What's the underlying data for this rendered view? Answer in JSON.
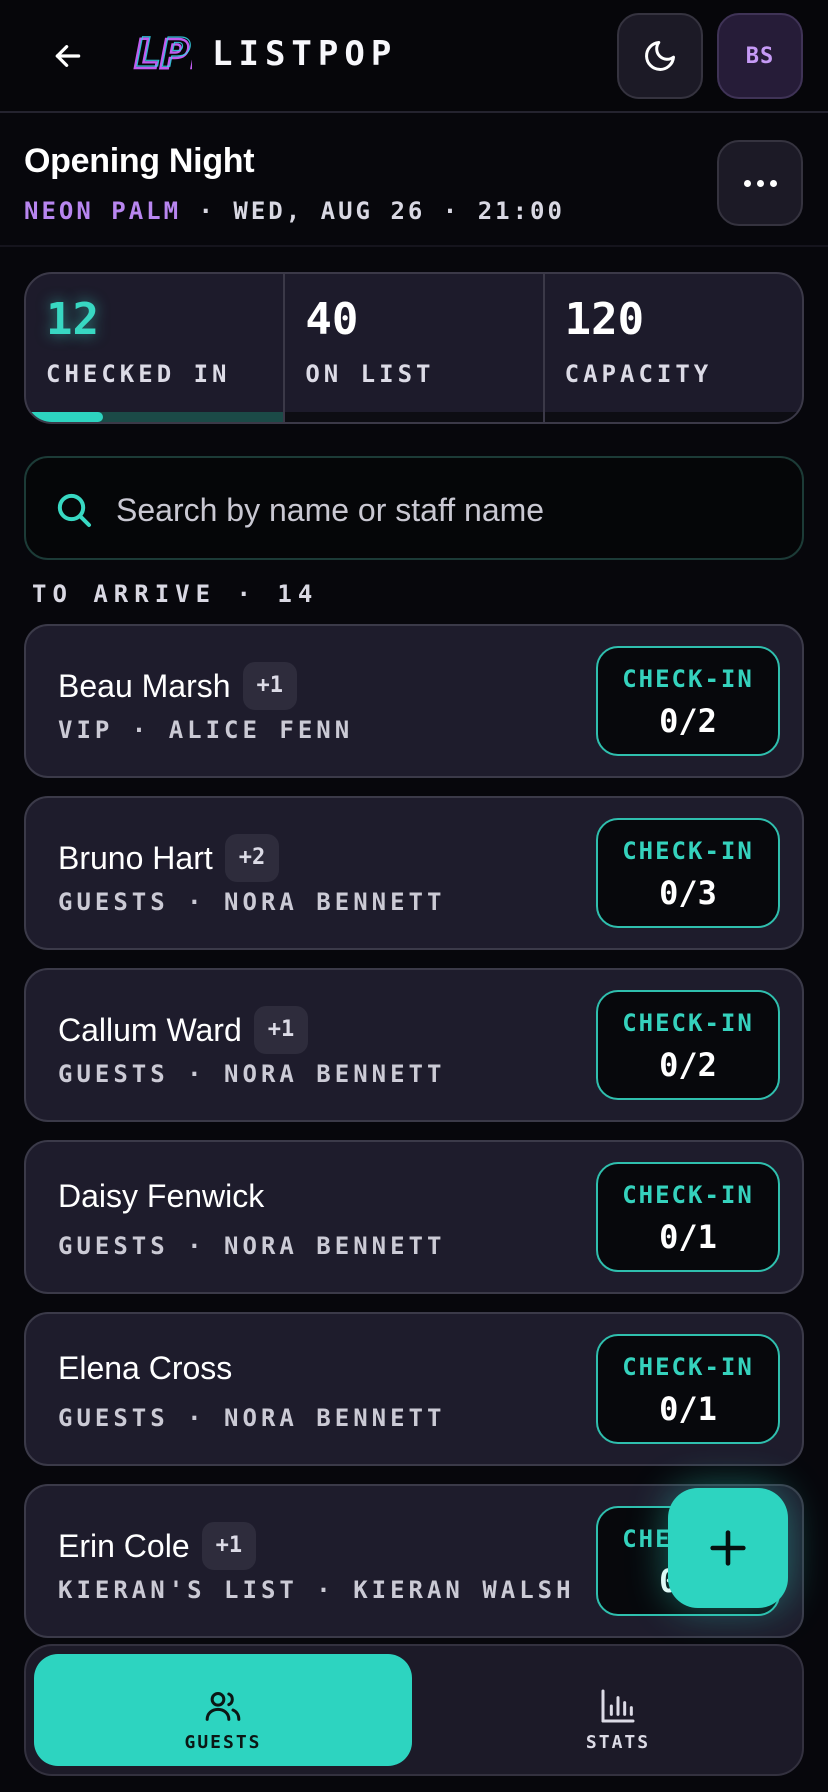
{
  "header": {
    "brand": "LISTPOP",
    "logo_text": "LP!",
    "avatar_initials": "BS"
  },
  "event": {
    "title": "Opening Night",
    "venue": "NEON PALM",
    "separator": "·",
    "date_time": "WED, AUG 26 · 21:00"
  },
  "stats": [
    {
      "value": "12",
      "label": "CHECKED IN"
    },
    {
      "value": "40",
      "label": "ON LIST"
    },
    {
      "value": "120",
      "label": "CAPACITY"
    }
  ],
  "progress": {
    "checked_in_fraction": 0.3
  },
  "search": {
    "placeholder": "Search by name or staff name",
    "value": ""
  },
  "section": {
    "title": "TO ARRIVE · 14"
  },
  "guests": [
    {
      "name": "Beau Marsh",
      "plus": "+1",
      "meta": "VIP · ALICE FENN",
      "checkin_label": "CHECK-IN",
      "count": "0/2"
    },
    {
      "name": "Bruno Hart",
      "plus": "+2",
      "meta": "GUESTS · NORA BENNETT",
      "checkin_label": "CHECK-IN",
      "count": "0/3"
    },
    {
      "name": "Callum Ward",
      "plus": "+1",
      "meta": "GUESTS · NORA BENNETT",
      "checkin_label": "CHECK-IN",
      "count": "0/2"
    },
    {
      "name": "Daisy Fenwick",
      "plus": "",
      "meta": "GUESTS · NORA BENNETT",
      "checkin_label": "CHECK-IN",
      "count": "0/1"
    },
    {
      "name": "Elena Cross",
      "plus": "",
      "meta": "GUESTS · NORA BENNETT",
      "checkin_label": "CHECK-IN",
      "count": "0/1"
    },
    {
      "name": "Erin Cole",
      "plus": "+1",
      "meta": "KIERAN'S LIST · KIERAN WALSH",
      "checkin_label": "CHECK-IN",
      "count": "0/2"
    }
  ],
  "nav": {
    "guests_label": "GUESTS",
    "stats_label": "STATS"
  },
  "colors": {
    "accent": "#2dd4c0",
    "venue": "#b886f0",
    "background": "#07070c",
    "card": "#1e1c2c"
  },
  "icons": [
    "back-arrow-icon",
    "moon-icon",
    "more-horizontal-icon",
    "search-icon",
    "plus-icon",
    "users-icon",
    "bar-chart-icon"
  ]
}
